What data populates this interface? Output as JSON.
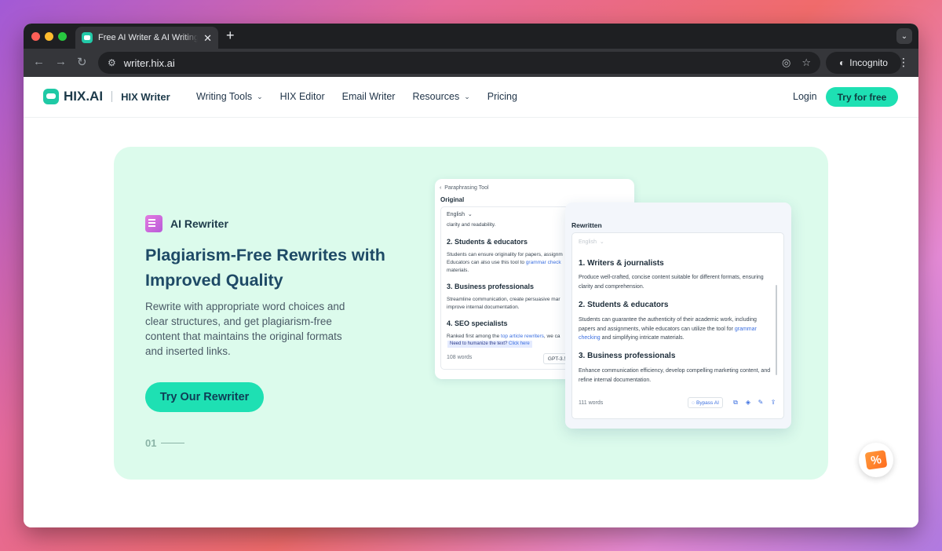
{
  "browser": {
    "tab_title": "Free AI Writer & AI Writing Assistant",
    "url": "writer.hix.ai",
    "incognito_label": "Incognito"
  },
  "nav": {
    "logo": "HIX.AI",
    "product": "HIX Writer",
    "items": [
      {
        "label": "Writing Tools",
        "has_caret": true
      },
      {
        "label": "HIX Editor",
        "has_caret": false
      },
      {
        "label": "Email Writer",
        "has_caret": false
      },
      {
        "label": "Resources",
        "has_caret": true
      },
      {
        "label": "Pricing",
        "has_caret": false
      }
    ],
    "login": "Login",
    "cta": "Try for free"
  },
  "hero": {
    "badge": "AI Rewriter",
    "headline": "Plagiarism-Free Rewrites with Improved Quality",
    "subtext": "Rewrite with appropriate word choices and clear structures, and get plagiarism-free content that maintains the original formats and inserted links.",
    "cta": "Try Our Rewriter",
    "page_index": "01"
  },
  "original_card": {
    "breadcrumb": "Paraphrasing Tool",
    "title": "Original",
    "language": "English",
    "snippet_top": "clarity and readability.",
    "h2": "2. Students & educators",
    "p2a": "Students can ensure originality for papers, assignm",
    "p2b_prefix": "Educators can also use this tool to ",
    "p2b_link": "grammar check",
    "p2c": "materials.",
    "h3": "3. Business professionals",
    "p3a": "Streamline communication, create persuasive mar",
    "p3b": "improve internal documentation.",
    "h4": "4. SEO specialists",
    "p4_prefix": "Ranked first among the ",
    "p4_link": "top article rewriters",
    "p4_suffix": ", we ca",
    "hint_prefix": "Need to humanize the text? ",
    "hint_link": "Click here",
    "word_count": "108 words",
    "model": "GPT-3.5"
  },
  "rewritten_card": {
    "title": "Rewritten",
    "language": "English",
    "h1": "1. Writers & journalists",
    "p1": "Produce well-crafted, concise content suitable for different formats, ensuring clarity and comprehension.",
    "h2": "2. Students & educators",
    "p2_prefix": "Students can guarantee the authenticity of their academic work, including papers and assignments, while educators can utilize the tool for ",
    "p2_link": "grammar checking",
    "p2_suffix": " and simplifying intricate materials.",
    "h3": "3. Business professionals",
    "p3": "Enhance communication efficiency, develop compelling marketing content, and refine internal documentation.",
    "word_count": "111 words",
    "bypass": "Bypass AI"
  },
  "promo_badge": "%",
  "colors": {
    "accent": "#1ee0b3",
    "hero_bg": "#dcfbec",
    "heading": "#1e4a66",
    "link": "#3b6fe0"
  }
}
